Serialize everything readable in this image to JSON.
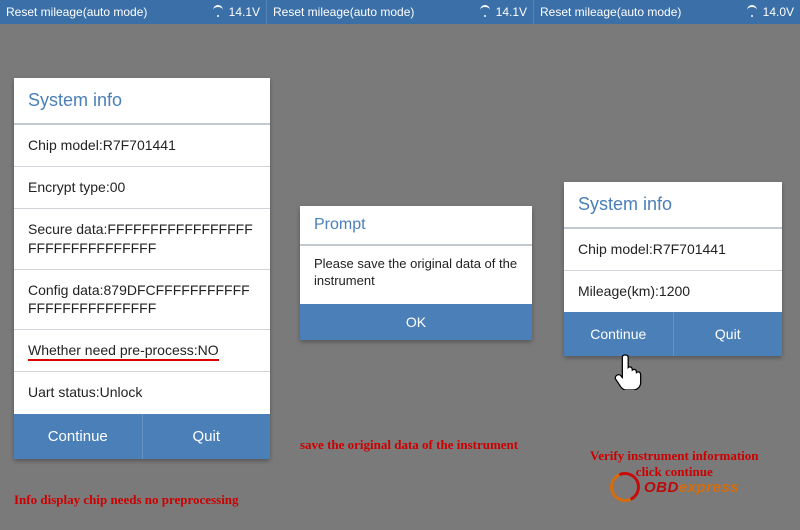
{
  "topbar": {
    "segments": [
      {
        "title": "Reset mileage(auto mode)",
        "voltage": "14.1V"
      },
      {
        "title": "Reset mileage(auto mode)",
        "voltage": "14.1V"
      },
      {
        "title": "Reset mileage(auto mode)",
        "voltage": "14.0V"
      }
    ]
  },
  "panel1": {
    "header": "System info",
    "rows": {
      "chip": "Chip model:R7F701441",
      "encrypt": "Encrypt type:00",
      "secure": "Secure data:FFFFFFFFFFFFFFFFFFFFFFFFFFFFFFFF",
      "config": "Config data:879DFCFFFFFFFFFFFFFFFFFFFFFFFFFF",
      "preproc": "Whether need pre-process:NO",
      "uart": "Uart status:Unlock"
    },
    "buttons": {
      "continue": "Continue",
      "quit": "Quit"
    }
  },
  "prompt": {
    "header": "Prompt",
    "body": "Please save the original data of the instrument",
    "ok": "OK"
  },
  "panel2": {
    "header": "System info",
    "rows": {
      "chip": "Chip model:R7F701441",
      "mileage": "Mileage(km):1200"
    },
    "buttons": {
      "continue": "Continue",
      "quit": "Quit"
    }
  },
  "captions": {
    "c1": "Info display chip needs no preprocessing",
    "c2": "save the original data of the instrument",
    "c3a": "Verify instrument information",
    "c3b": "click continue"
  },
  "watermark": {
    "prefix": "OBD",
    "suffix": "express"
  }
}
